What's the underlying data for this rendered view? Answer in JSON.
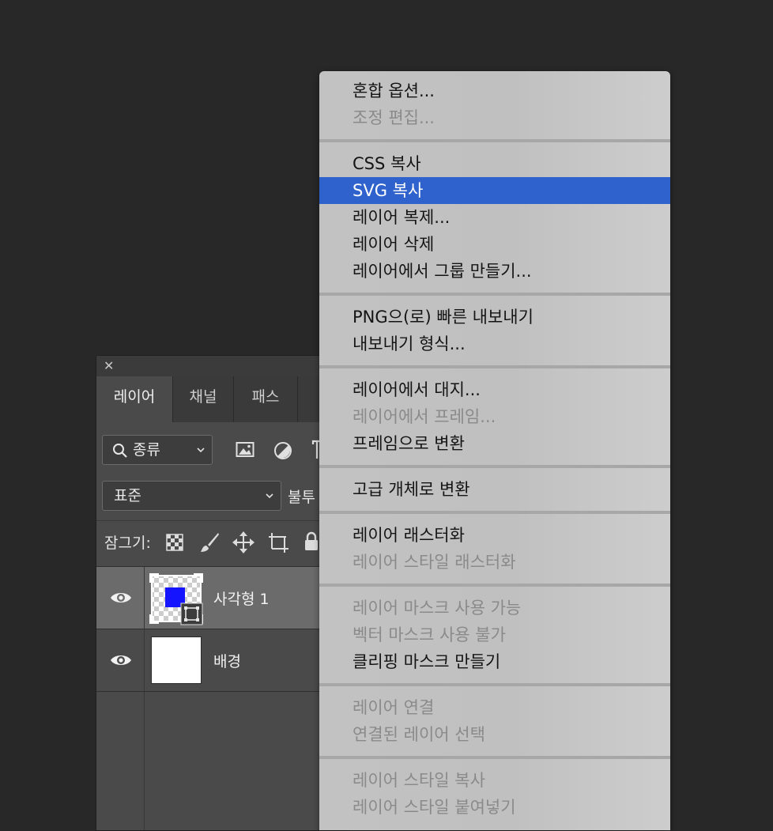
{
  "layers_panel": {
    "close_glyph": "✕",
    "tabs": [
      "레이어",
      "채널",
      "패스"
    ],
    "filter_dropdown": {
      "label": "종류",
      "icon": "search-icon"
    },
    "filter_icons": [
      "image-filter-icon",
      "adjustment-filter-icon",
      "type-filter-icon"
    ],
    "blend_mode": "표준",
    "opacity_label_partial": "불투",
    "lock_label": "잠그기:",
    "lock_icons": [
      "lock-transparent-icon",
      "lock-paint-icon",
      "lock-position-icon",
      "lock-artboard-icon",
      "lock-all-icon"
    ],
    "layers": [
      {
        "name": "사각형 1",
        "selected": true,
        "visible": true,
        "thumb_fill": "#1414ff"
      },
      {
        "name": "배경",
        "selected": false,
        "visible": true,
        "thumb_fill": "#ffffff"
      }
    ]
  },
  "context_menu": {
    "highlight_color": "#2f62cc",
    "groups": [
      [
        {
          "label": "혼합 옵션...",
          "enabled": true
        },
        {
          "label": "조정 편집...",
          "enabled": false
        }
      ],
      [
        {
          "label": "CSS 복사",
          "enabled": true
        },
        {
          "label": "SVG 복사",
          "enabled": true,
          "highlighted": true
        },
        {
          "label": "레이어 복제...",
          "enabled": true
        },
        {
          "label": "레이어 삭제",
          "enabled": true
        },
        {
          "label": "레이어에서 그룹 만들기...",
          "enabled": true
        }
      ],
      [
        {
          "label": "PNG으(로) 빠른 내보내기",
          "enabled": true
        },
        {
          "label": "내보내기 형식...",
          "enabled": true
        }
      ],
      [
        {
          "label": "레이어에서 대지...",
          "enabled": true
        },
        {
          "label": "레이어에서 프레임...",
          "enabled": false
        },
        {
          "label": "프레임으로 변환",
          "enabled": true
        }
      ],
      [
        {
          "label": "고급 개체로 변환",
          "enabled": true
        }
      ],
      [
        {
          "label": "레이어 래스터화",
          "enabled": true
        },
        {
          "label": "레이어 스타일 래스터화",
          "enabled": false
        }
      ],
      [
        {
          "label": "레이어 마스크 사용 가능",
          "enabled": false
        },
        {
          "label": "벡터 마스크 사용 불가",
          "enabled": false
        },
        {
          "label": "클리핑 마스크 만들기",
          "enabled": true
        }
      ],
      [
        {
          "label": "레이어 연결",
          "enabled": false
        },
        {
          "label": "연결된 레이어 선택",
          "enabled": false
        }
      ],
      [
        {
          "label": "레이어 스타일 복사",
          "enabled": false
        },
        {
          "label": "레이어 스타일 붙여넣기",
          "enabled": false
        }
      ]
    ]
  }
}
